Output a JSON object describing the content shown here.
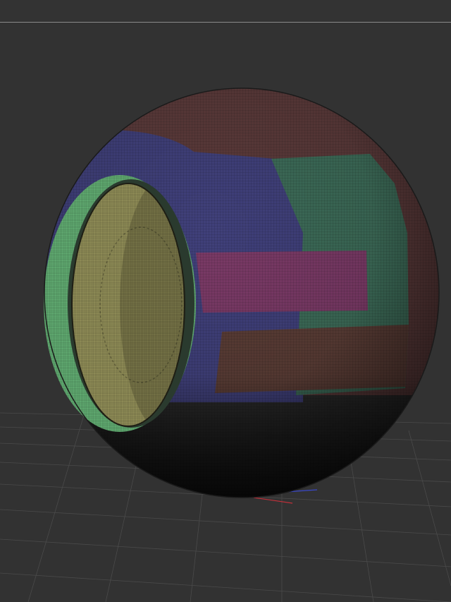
{
  "app": {
    "type": "3d-sculpt-viewport"
  },
  "colors": {
    "background": "#323232",
    "divider": "#8a8a8a",
    "floor_grid": "#4a4a4a",
    "axis_x": "#c0303a",
    "axis_z": "#3a48c8"
  },
  "viewport": {
    "model": "sphere-mesh",
    "polygroups": [
      {
        "id": "red-cap",
        "color": "#5a3a3a"
      },
      {
        "id": "blue-band",
        "color": "#40407a"
      },
      {
        "id": "green-panel",
        "color": "#3d6b58"
      },
      {
        "id": "magenta-panel",
        "color": "#7a3a66"
      },
      {
        "id": "brown-panel",
        "color": "#5a3d36"
      },
      {
        "id": "yellow-disc",
        "color": "#8d8a55"
      },
      {
        "id": "green-rim",
        "color": "#5fa86f"
      },
      {
        "id": "dark-bottom",
        "color": "#2a2a2a"
      }
    ]
  }
}
